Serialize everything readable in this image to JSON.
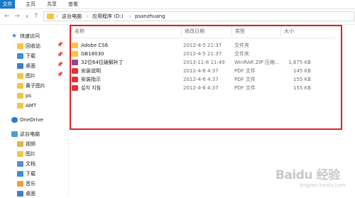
{
  "ribbon": {
    "tabs": [
      "文件",
      "主页",
      "共享",
      "查看"
    ]
  },
  "address": {
    "crumbs": [
      "这台电脑",
      "应用程序 (D:)",
      "psanzhuang"
    ],
    "separator": "›"
  },
  "nav": {
    "back": "←",
    "forward": "→",
    "dropdown": "∨",
    "up": "↑"
  },
  "sidebar": {
    "items": [
      {
        "label": "快速访问",
        "icon": "star-icon"
      },
      {
        "label": "回收站",
        "icon": "folder-icon",
        "pinned": true
      },
      {
        "label": "下载",
        "icon": "download-icon",
        "pinned": true
      },
      {
        "label": "桌面",
        "icon": "desktop-icon",
        "pinned": true
      },
      {
        "label": "图片",
        "icon": "folder-icon",
        "pinned": true
      },
      {
        "label": "黄子图片",
        "icon": "folder-icon"
      },
      {
        "label": "ps",
        "icon": "folder-icon"
      },
      {
        "label": "AMT",
        "icon": "folder-icon"
      },
      {
        "label": "OneDrive",
        "icon": "cloud-icon"
      },
      {
        "label": "这台电脑",
        "icon": "computer-icon"
      },
      {
        "label": "视频",
        "icon": "video-icon"
      },
      {
        "label": "图片",
        "icon": "picture-icon"
      },
      {
        "label": "文档",
        "icon": "document-icon"
      },
      {
        "label": "下载",
        "icon": "download-icon"
      },
      {
        "label": "音乐",
        "icon": "music-icon"
      },
      {
        "label": "桌面",
        "icon": "desktop-icon"
      }
    ],
    "pin_glyph": "📌"
  },
  "columns": {
    "name": "名称",
    "date": "修改日期",
    "type": "类型",
    "size": "大小"
  },
  "files": [
    {
      "name": "Adobe CS6",
      "date": "2012-4-5 21:37",
      "type": "文件夹",
      "size": "",
      "icon": "folder"
    },
    {
      "name": "GB18030",
      "date": "2012-4-5 21:37",
      "type": "文件夹",
      "size": "",
      "icon": "folder"
    },
    {
      "name": "32位64位破解补丁",
      "date": "2013-11-8 11:49",
      "type": "WinRAR ZIP 压缩...",
      "size": "1,675 KB",
      "icon": "zip"
    },
    {
      "name": "安装说明",
      "date": "2012-4-6 4:37",
      "type": "PDF 文件",
      "size": "145 KB",
      "icon": "pdf"
    },
    {
      "name": "安装指示",
      "date": "2012-4-6 4:37",
      "type": "PDF 文件",
      "size": "155 KB",
      "icon": "pdf"
    },
    {
      "name": "설치 지침",
      "date": "2012-4-6 4:37",
      "type": "PDF 文件",
      "size": "155 KB",
      "icon": "pdf"
    }
  ],
  "watermark": {
    "main": "Baidu 经验",
    "sub": "jingyan.baidu.com"
  },
  "colors": {
    "accent": "#1979ca",
    "highlight_border": "#e0202a",
    "folder": "#f5c542"
  }
}
